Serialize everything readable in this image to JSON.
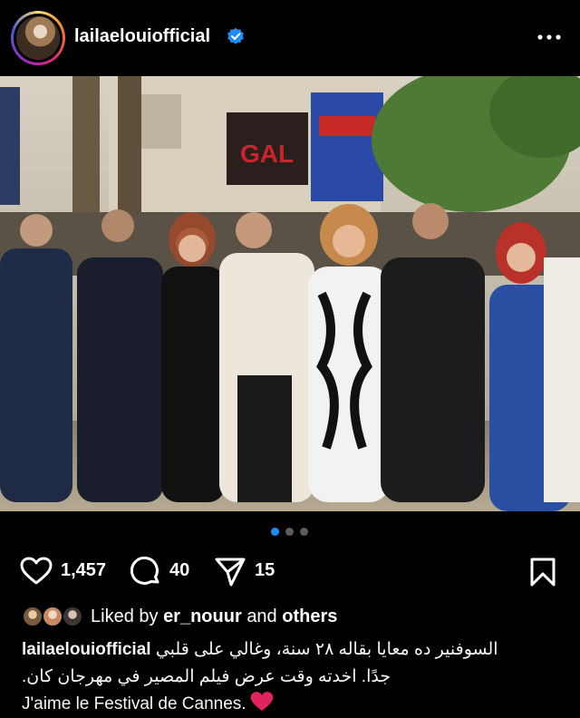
{
  "post": {
    "username": "lailaelouiofficial",
    "verified": true
  },
  "carousel": {
    "count": 3,
    "active_index": 0
  },
  "actions": {
    "likes": "1,457",
    "comments": "40",
    "shares": "15"
  },
  "liked_by": {
    "prefix": "Liked by",
    "user": "er_nouur",
    "joiner": "and",
    "others": "others"
  },
  "caption": {
    "username": "lailaelouiofficial",
    "line1": "السوفنير ده معايا بقاله ٢٨ سنة، وغالي على قلبي",
    "line2": "جدًا. اخدته وقت عرض فيلم المصير في مهرجان كان.",
    "line3": "J'aime le Festival de Cannes."
  },
  "colors": {
    "accent_blue": "#1d8cf8",
    "heart_red": "#e0245e",
    "background": "#000000"
  },
  "icons": {
    "verified": "verified-badge-icon",
    "more": "more-horizontal-icon",
    "like": "heart-outline-icon",
    "comment": "comment-bubble-icon",
    "share": "paper-plane-icon",
    "save": "bookmark-icon"
  }
}
